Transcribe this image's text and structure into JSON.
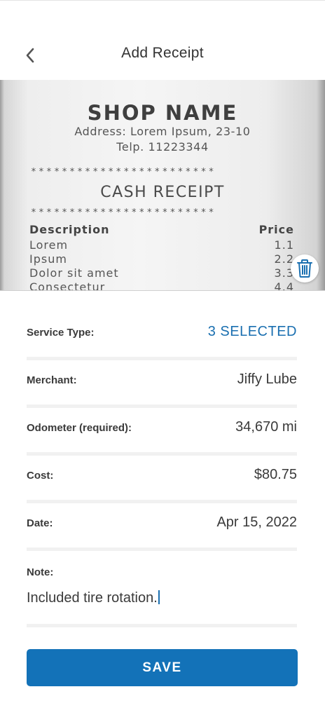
{
  "header": {
    "title": "Add Receipt",
    "back_icon": "chevron-left-icon"
  },
  "receipt_image": {
    "shop_name": "SHOP NAME",
    "address": "Address: Lorem Ipsum, 23-10",
    "telp": "Telp. 11223344",
    "stars": "************************",
    "title": "CASH RECEIPT",
    "description_header": "Description",
    "price_header": "Price",
    "items": [
      {
        "name": "Lorem",
        "price": "1.1"
      },
      {
        "name": "Ipsum",
        "price": "2.2"
      },
      {
        "name": "Dolor sit amet",
        "price": "3.3"
      },
      {
        "name": "Consectetur",
        "price": "4.4"
      }
    ],
    "delete_icon": "trash-icon"
  },
  "form": {
    "service_type": {
      "label": "Service Type:",
      "value": "3 SELECTED"
    },
    "merchant": {
      "label": "Merchant:",
      "value": "Jiffy Lube"
    },
    "odometer": {
      "label": "Odometer (required):",
      "value": "34,670 mi"
    },
    "cost": {
      "label": "Cost:",
      "value": "$80.75"
    },
    "date": {
      "label": "Date:",
      "value": "Apr 15, 2022"
    },
    "note": {
      "label": "Note:",
      "value": "Included tire rotation."
    }
  },
  "save_label": "SAVE",
  "colors": {
    "accent": "#1372b8",
    "link": "#1a6fb0",
    "text": "#3a3a3a"
  }
}
